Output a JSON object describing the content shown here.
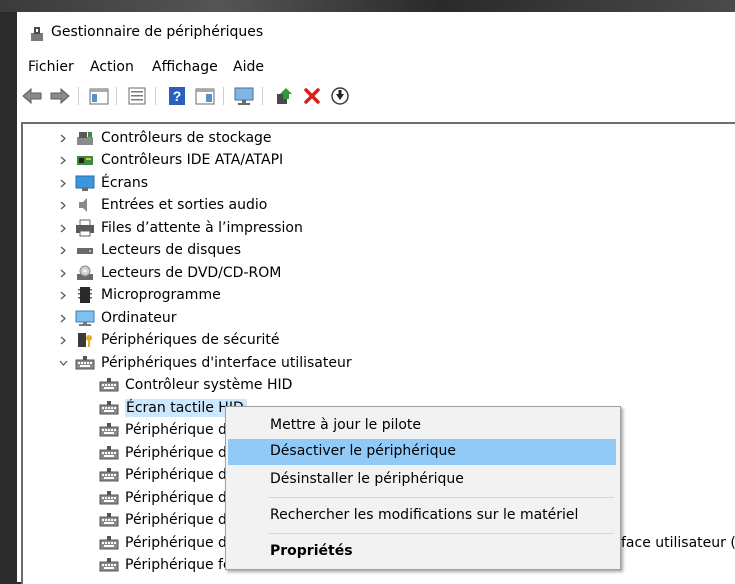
{
  "window": {
    "title": "Gestionnaire de périphériques"
  },
  "menu": [
    "Fichier",
    "Action",
    "Affichage",
    "Aide"
  ],
  "toolbar": [
    "back-arrow-icon",
    "forward-arrow-icon",
    "show-hide-tree-icon",
    "properties-icon",
    "help-icon",
    "view-icon",
    "computer-monitor-icon",
    "update-driver-icon",
    "uninstall-x-icon",
    "disable-device-icon"
  ],
  "tree": {
    "categories": [
      {
        "label": "Contrôleurs de stockage",
        "icon": "storage-controller-icon",
        "expanded": false
      },
      {
        "label": "Contrôleurs IDE ATA/ATAPI",
        "icon": "ide-controller-icon",
        "expanded": false
      },
      {
        "label": "Écrans",
        "icon": "monitor-icon",
        "expanded": false
      },
      {
        "label": "Entrées et sorties audio",
        "icon": "speaker-icon",
        "expanded": false
      },
      {
        "label": "Files d’attente à l’impression",
        "icon": "printer-icon",
        "expanded": false
      },
      {
        "label": "Lecteurs de disques",
        "icon": "disk-drive-icon",
        "expanded": false
      },
      {
        "label": "Lecteurs de DVD/CD-ROM",
        "icon": "dvd-drive-icon",
        "expanded": false
      },
      {
        "label": "Microprogramme",
        "icon": "firmware-chip-icon",
        "expanded": false
      },
      {
        "label": "Ordinateur",
        "icon": "computer-icon",
        "expanded": false
      },
      {
        "label": "Périphériques de sécurité",
        "icon": "security-key-icon",
        "expanded": false
      },
      {
        "label": "Périphériques d'interface utilisateur",
        "icon": "hid-keyboard-icon",
        "expanded": true
      }
    ],
    "children": [
      {
        "label": "Contrôleur système HID",
        "selected": false
      },
      {
        "label": "Écran tactile HID",
        "selected": true
      },
      {
        "label": "Périphérique d’",
        "selected": false
      },
      {
        "label": "Périphérique d’",
        "selected": false
      },
      {
        "label": "Périphérique d’",
        "selected": false
      },
      {
        "label": "Périphérique d’",
        "selected": false
      },
      {
        "label": "Périphérique d’",
        "selected": false
      },
      {
        "label": "Périphérique de",
        "selected": false,
        "trailing": "face utilisateur (HI"
      },
      {
        "label": "Périphérique fournisseur HID",
        "selected": false
      }
    ]
  },
  "context_menu": {
    "items": [
      {
        "label": "Mettre à jour le pilote",
        "highlighted": false,
        "bold": false
      },
      {
        "label": "Désactiver le périphérique",
        "highlighted": true,
        "bold": false
      },
      {
        "label": "Désinstaller le périphérique",
        "highlighted": false,
        "bold": false
      },
      {
        "label": "Rechercher les modifications sur le matériel",
        "highlighted": false,
        "bold": false
      },
      {
        "label": "Propriétés",
        "highlighted": false,
        "bold": true
      }
    ]
  },
  "colors": {
    "selection": "#cce8ff",
    "menu_highlight": "#91c9f7",
    "menu_bg": "#f2f2f2"
  }
}
